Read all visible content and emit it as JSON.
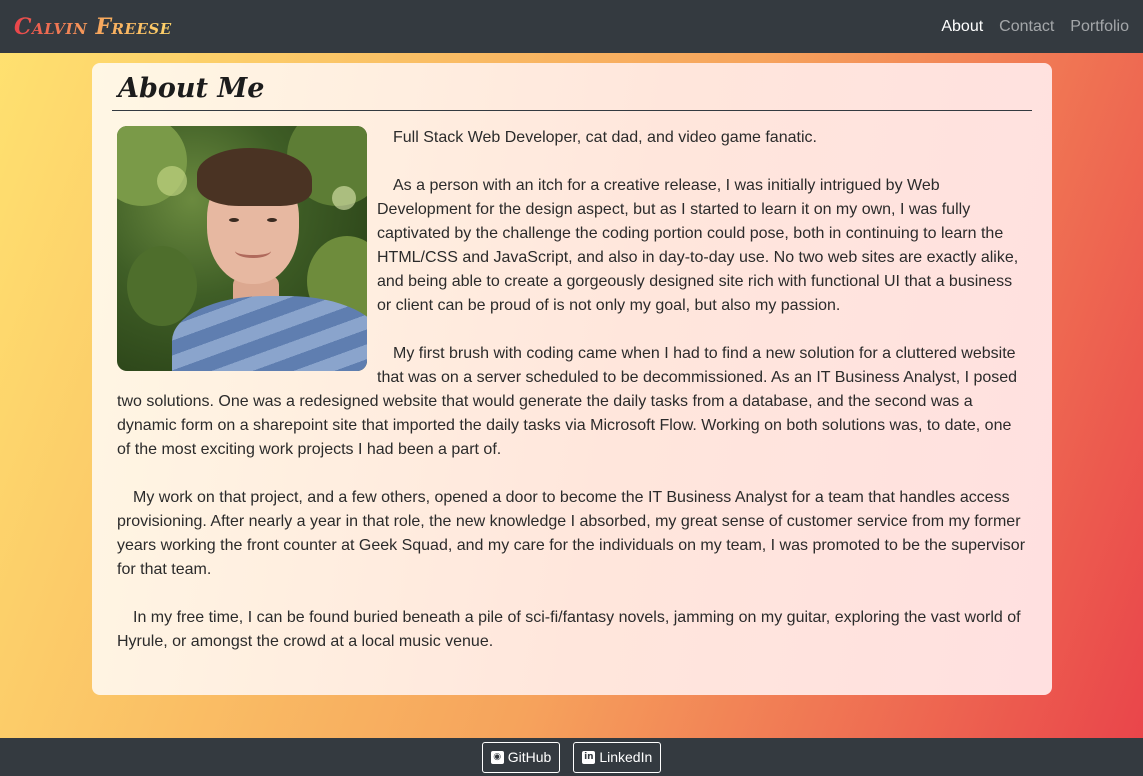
{
  "navbar": {
    "brand": "Calvin Freese",
    "links": [
      {
        "label": "About",
        "active": true
      },
      {
        "label": "Contact",
        "active": false
      },
      {
        "label": "Portfolio",
        "active": false
      }
    ]
  },
  "about": {
    "title": "About Me",
    "paragraphs": [
      "Full Stack Web Developer, cat dad, and video game fanatic.",
      "As a person with an itch for a creative release, I was initially intrigued by Web Development for the design aspect, but as I started to learn it on my own, I was fully captivated by the challenge the coding portion could pose, both in continuing to learn the HTML/CSS and JavaScript, and also in day-to-day use. No two web sites are exactly alike, and being able to create a gorgeously designed site rich with functional UI that a business or client can be proud of is not only my goal, but also my passion.",
      "My first brush with coding came when I had to find a new solution for a cluttered website that was on a server scheduled to be decommissioned. As an IT Business Analyst, I posed two solutions. One was a redesigned website that would generate the daily tasks from a database, and the second was a dynamic form on a sharepoint site that imported the daily tasks via Microsoft Flow. Working on both solutions was, to date, one of the most exciting work projects I had been a part of.",
      "My work on that project, and a few others, opened a door to become the IT Business Analyst for a team that handles access provisioning. After nearly a year in that role, the new knowledge I absorbed, my great sense of customer service from my former years working the front counter at Geek Squad, and my care for the individuals on my team, I was promoted to be the supervisor for that team.",
      "In my free time, I can be found buried beneath a pile of sci-fi/fantasy novels, jamming on my guitar, exploring the vast world of Hyrule, or amongst the crowd at a local music venue."
    ]
  },
  "footer": {
    "buttons": [
      {
        "label": "GitHub",
        "icon": "github-icon"
      },
      {
        "label": "LinkedIn",
        "icon": "linkedin-icon"
      }
    ]
  },
  "colors": {
    "navbar_bg": "#343a40",
    "gradient_start": "#ffe270",
    "gradient_end": "#e9434a",
    "brand_red": "#e9434a",
    "brand_yellow": "#ffd46a"
  }
}
